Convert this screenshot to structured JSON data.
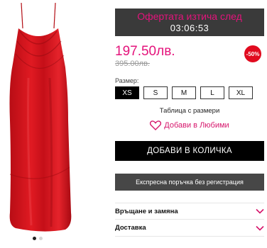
{
  "offer": {
    "label": "Офертата изтича след",
    "timer": "03:06:53"
  },
  "price": {
    "current": "197.50лв.",
    "old": "395.00лв.",
    "discount": "-50%"
  },
  "sizes": {
    "label": "Размер:",
    "options": [
      "XS",
      "S",
      "M",
      "L",
      "XL"
    ],
    "selected": "XS",
    "table_link": "Таблица с размери"
  },
  "wishlist": {
    "label": "Добави в Любими",
    "icon": "heart-icon"
  },
  "actions": {
    "add_to_cart": "ДОБАВИ В КОЛИЧКА",
    "express_order": "Експресна поръчка без регистрация"
  },
  "accordion": [
    {
      "label": "Връщане и замяна",
      "icon": "chevron-down-icon"
    },
    {
      "label": "Доставка",
      "icon": "chevron-down-icon"
    }
  ],
  "gallery": {
    "slides": 2,
    "active_slide": 1
  },
  "colors": {
    "accent": "#e4137b",
    "badge": "#e10b1f",
    "dress": "#d8141c",
    "dark": "#3a3a3a"
  }
}
